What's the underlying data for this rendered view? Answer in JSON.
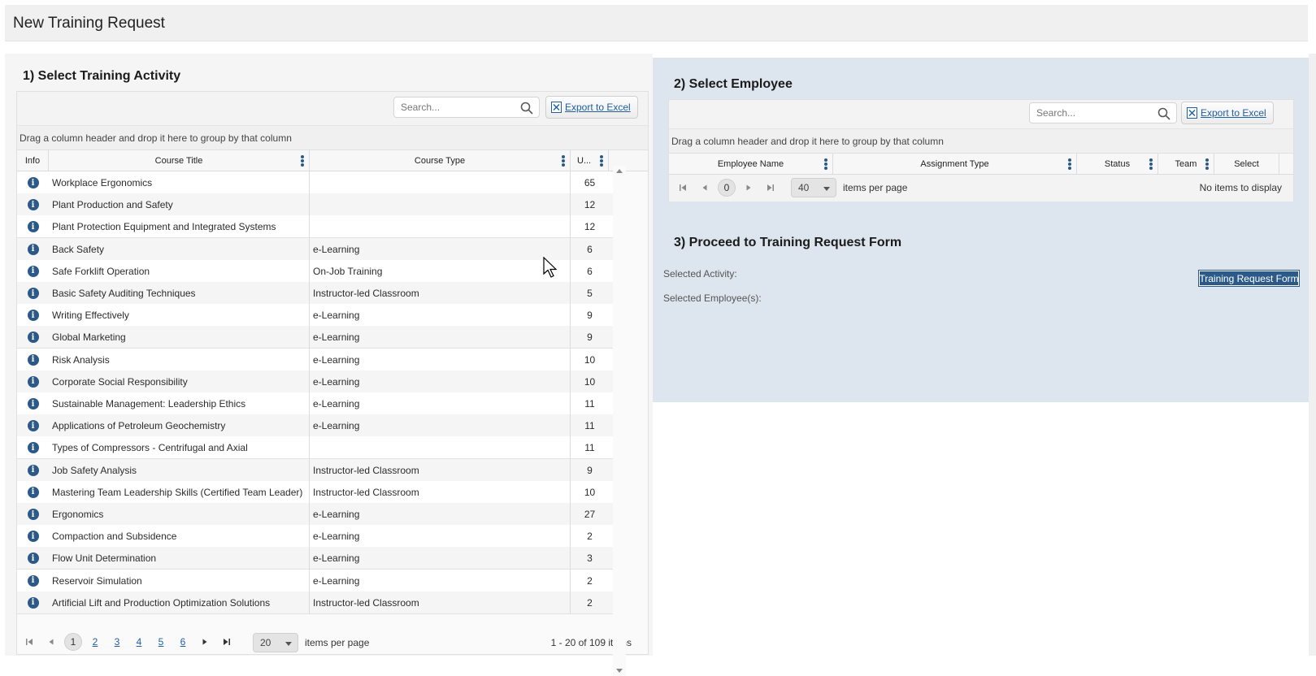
{
  "page": {
    "title": "New Training Request"
  },
  "activity": {
    "title": "1) Select Training Activity",
    "search_placeholder": "Search...",
    "export_label": "Export to Excel",
    "group_hint": "Drag a column header and drop it here to group by that column",
    "columns": {
      "info": "Info",
      "course_title": "Course Title",
      "course_type": "Course Type",
      "units": "U..."
    },
    "rows": [
      {
        "title": "Workplace Ergonomics",
        "type": "",
        "units": "65"
      },
      {
        "title": "Plant Production and Safety",
        "type": "",
        "units": "12"
      },
      {
        "title": "Plant Protection Equipment and Integrated Systems",
        "type": "",
        "units": "12"
      },
      {
        "title": "Back Safety",
        "type": "e-Learning",
        "units": "6"
      },
      {
        "title": "Safe Forklift Operation",
        "type": "On-Job Training",
        "units": "6"
      },
      {
        "title": "Basic Safety Auditing Techniques",
        "type": "Instructor-led Classroom",
        "units": "5"
      },
      {
        "title": "Writing Effectively",
        "type": "e-Learning",
        "units": "9"
      },
      {
        "title": "Global Marketing",
        "type": "e-Learning",
        "units": "9"
      },
      {
        "title": "Risk Analysis",
        "type": "e-Learning",
        "units": "10"
      },
      {
        "title": "Corporate Social Responsibility",
        "type": "e-Learning",
        "units": "10"
      },
      {
        "title": "Sustainable Management: Leadership Ethics",
        "type": "e-Learning",
        "units": "11"
      },
      {
        "title": "Applications of Petroleum Geochemistry",
        "type": "e-Learning",
        "units": "11"
      },
      {
        "title": "Types of Compressors - Centrifugal and Axial",
        "type": "",
        "units": "11"
      },
      {
        "title": "Job Safety Analysis",
        "type": "Instructor-led Classroom",
        "units": "9"
      },
      {
        "title": "Mastering Team Leadership Skills (Certified Team Leader)",
        "type": "Instructor-led Classroom",
        "units": "10"
      },
      {
        "title": "Ergonomics",
        "type": "e-Learning",
        "units": "27"
      },
      {
        "title": "Compaction and Subsidence",
        "type": "e-Learning",
        "units": "2"
      },
      {
        "title": "Flow Unit Determination",
        "type": "e-Learning",
        "units": "3"
      },
      {
        "title": "Reservoir Simulation",
        "type": "e-Learning",
        "units": "2"
      },
      {
        "title": "Artificial Lift and Production Optimization Solutions",
        "type": "Instructor-led Classroom",
        "units": "2"
      }
    ],
    "pager": {
      "pages": [
        "1",
        "2",
        "3",
        "4",
        "5",
        "6"
      ],
      "current_page": "1",
      "page_size": "20",
      "items_per_page_label": "items per page",
      "summary": "1 - 20 of 109 items"
    }
  },
  "employee": {
    "title": "2) Select Employee",
    "search_placeholder": "Search...",
    "export_label": "Export to Excel",
    "group_hint": "Drag a column header and drop it here to group by that column",
    "columns": {
      "employee_name": "Employee Name",
      "assignment_type": "Assignment Type",
      "status": "Status",
      "team": "Team",
      "select": "Select"
    },
    "pager": {
      "current_page": "0",
      "page_size": "40",
      "items_per_page_label": "items per page",
      "summary": "No items to display"
    }
  },
  "proceed": {
    "title": "3) Proceed to Training Request Form",
    "selected_activity_label": "Selected Activity:",
    "selected_employees_label": "Selected Employee(s):",
    "button_label": "Training Request Form"
  },
  "colors": {
    "accent": "#2c5a88",
    "panel_right_bg": "#dde5ee",
    "link": "#1f5f9f"
  },
  "icons": {
    "search": "search-icon",
    "export": "excel-icon",
    "info": "info-icon",
    "kebab": "column-menu-icon"
  }
}
